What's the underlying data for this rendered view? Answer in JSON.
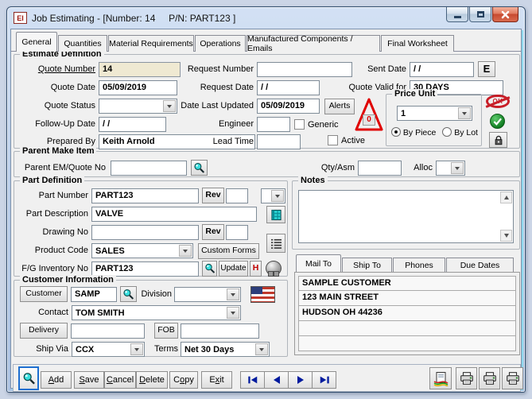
{
  "window": {
    "title": "Job Estimating - [Number: 14     P/N: PART123 ]",
    "icon_text": "EI"
  },
  "tabs": [
    "General",
    "Quantities",
    "Material Requirements",
    "Operations",
    "Manufactured Components / Emails",
    "Final Worksheet"
  ],
  "active_tab": "General",
  "estimate": {
    "title": "Estimate Definition",
    "quote_number_label": "Quote Number",
    "quote_number": "14",
    "request_number_label": "Request Number",
    "request_number": "",
    "sent_date_label": "Sent Date",
    "sent_date": "/ /",
    "e_button": "E",
    "quote_date_label": "Quote Date",
    "quote_date": "05/09/2019",
    "request_date_label": "Request Date",
    "request_date": "/ /",
    "quote_valid_label": "Quote Valid for",
    "quote_valid": "30 DAYS",
    "quote_status_label": "Quote Status",
    "quote_status": "",
    "date_last_updated_label": "Date Last Updated",
    "date_last_updated": "05/09/2019",
    "alerts_button": "Alerts",
    "alert_count": "0",
    "follow_up_label": "Follow-Up Date",
    "follow_up": "/ /",
    "engineer_label": "Engineer",
    "engineer": "",
    "generic_label": "Generic",
    "generic_checked": false,
    "prepared_by_label": "Prepared By",
    "prepared_by": "Keith Arnold",
    "lead_time_label": "Lead Time",
    "lead_time": "",
    "active_label": "Active",
    "active_checked": false,
    "price_unit": {
      "title": "Price Unit",
      "value": "1",
      "by_piece": "By Piece",
      "by_lot": "By Lot",
      "selected": "By Piece"
    }
  },
  "parent": {
    "title": "Parent Make Item",
    "em_label": "Parent EM/Quote No",
    "em": "",
    "qty_label": "Qty/Asm",
    "qty": "",
    "alloc_label": "Alloc",
    "alloc": ""
  },
  "part": {
    "title": "Part Definition",
    "part_number_label": "Part Number",
    "part_number": "PART123",
    "rev_button": "Rev",
    "part_rev": "",
    "desc_label": "Part Description",
    "desc": "VALVE",
    "drawing_label": "Drawing No",
    "drawing": "",
    "drawing_rev": "",
    "product_label": "Product Code",
    "product": "SALES",
    "custom_forms_button": "Custom Forms",
    "fg_label": "F/G Inventory No",
    "fg": "PART123",
    "update_button": "Update",
    "h_button": "H"
  },
  "notes": {
    "title": "Notes",
    "text": ""
  },
  "mail": {
    "tabs": [
      "Mail To",
      "Ship To",
      "Phones",
      "Due Dates"
    ],
    "active": "Mail To",
    "lines": [
      "SAMPLE CUSTOMER",
      "123 MAIN STREET",
      "HUDSON  OH 44236",
      "",
      ""
    ]
  },
  "customer": {
    "title": "Customer Information",
    "customer_button": "Customer",
    "customer": "SAMP",
    "division_label": "Division",
    "division": "",
    "contact_label": "Contact",
    "contact": "TOM SMITH",
    "delivery_button": "Delivery",
    "delivery": "",
    "fob_button": "FOB",
    "fob": "",
    "ship_via_label": "Ship Via",
    "ship_via": "CCX",
    "terms_label": "Terms",
    "terms": "Net 30 Days"
  },
  "toolbar": {
    "buttons": [
      {
        "text": "Add",
        "u": 0
      },
      {
        "text": "Save",
        "u": 0
      },
      {
        "text": "Cancel",
        "u": 0
      },
      {
        "text": "Delete",
        "u": 0
      },
      {
        "text": "Copy",
        "u": 1
      },
      {
        "text": "Exit",
        "u": 1
      }
    ]
  },
  "colors": {
    "accent_red": "#c81e28",
    "accent_green": "#0d7a1f",
    "nav_blue": "#001a9e",
    "field_beige": "#efe9d2"
  }
}
